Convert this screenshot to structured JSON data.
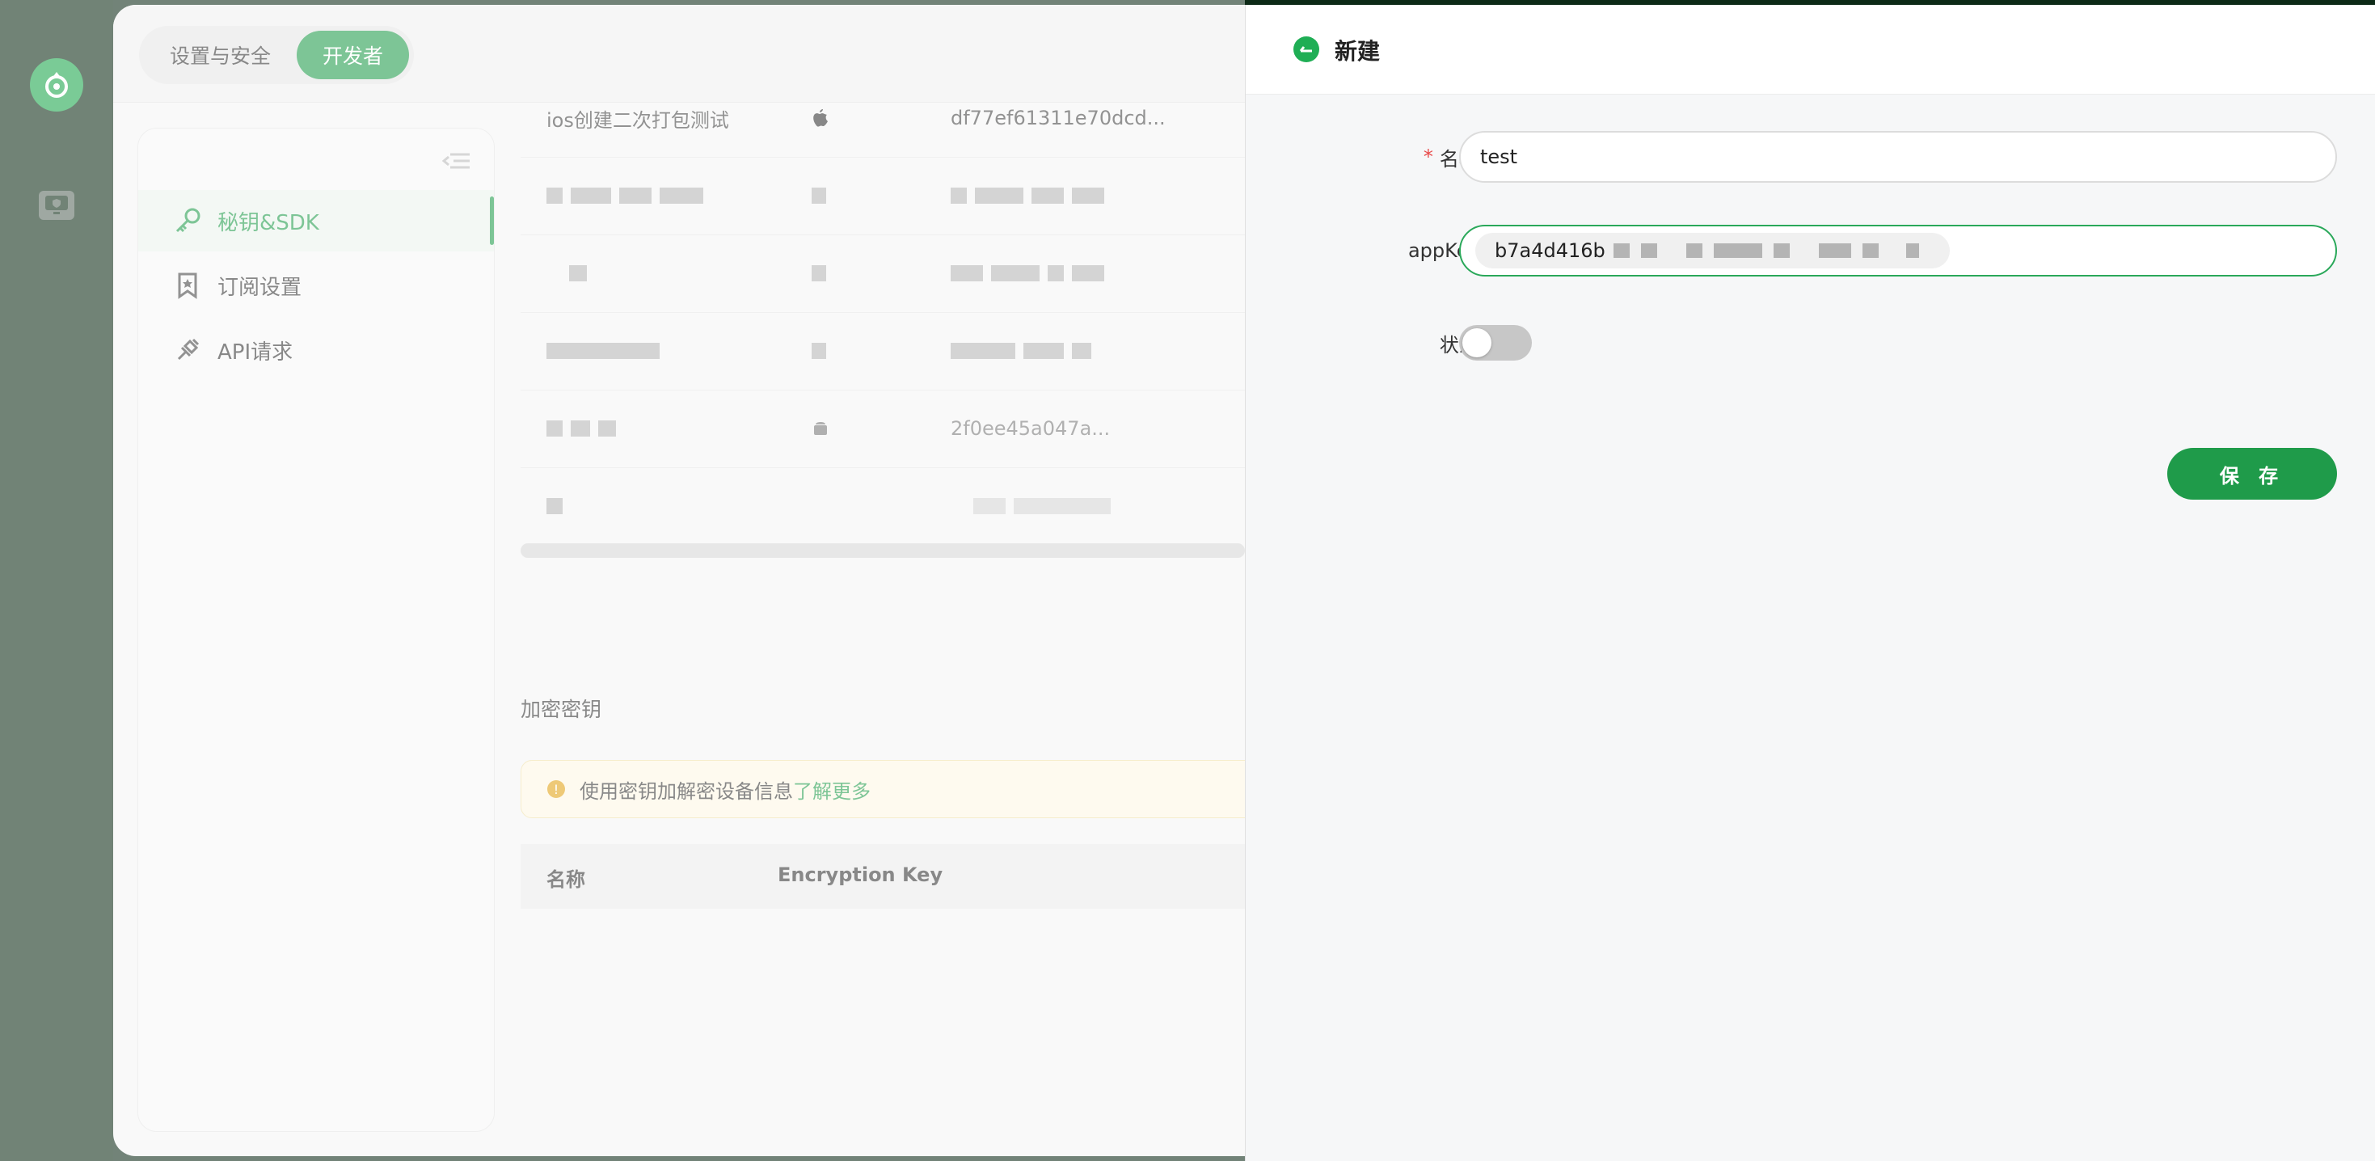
{
  "top_tabs": [
    {
      "label": "设置与安全",
      "active": false
    },
    {
      "label": "开发者",
      "active": true
    }
  ],
  "sidebar": {
    "items": [
      {
        "label": "秘钥&SDK",
        "icon": "key-icon",
        "active": true
      },
      {
        "label": "订阅设置",
        "icon": "bookmark-icon",
        "active": false
      },
      {
        "label": "API请求",
        "icon": "link-plug-icon",
        "active": false
      }
    ]
  },
  "apps_table": {
    "rows": [
      {
        "name": "ios创建二次打包测试",
        "platform_icon": "apple-icon",
        "key": "df77ef61311e70dcd..."
      },
      {
        "name": "",
        "platform_icon": "",
        "key": ""
      },
      {
        "name": "",
        "platform_icon": "",
        "key": ""
      },
      {
        "name": "",
        "platform_icon": "",
        "key": ""
      },
      {
        "name": "",
        "platform_icon": "android-icon",
        "key": "2f0ee45a047a..."
      },
      {
        "name": "",
        "platform_icon": "",
        "key": ""
      }
    ]
  },
  "encryption": {
    "title": "加密密钥",
    "alert_text": "使用密钥加解密设备信息",
    "alert_link": "了解更多",
    "columns": [
      "名称",
      "Encryption Key"
    ]
  },
  "drawer": {
    "title": "新建",
    "fields": {
      "name_label": "名称:",
      "name_value": "test",
      "appkey_label": "appKey:",
      "appkey_value": "b7a4d416b",
      "status_label": "状态:",
      "status_on": false
    },
    "save_label": "保 存"
  },
  "colors": {
    "brand_green": "#1f9b4a",
    "rail_bg": "#0b2a13",
    "required_red": "#e84a4a",
    "warning_amber": "#e2a215"
  }
}
